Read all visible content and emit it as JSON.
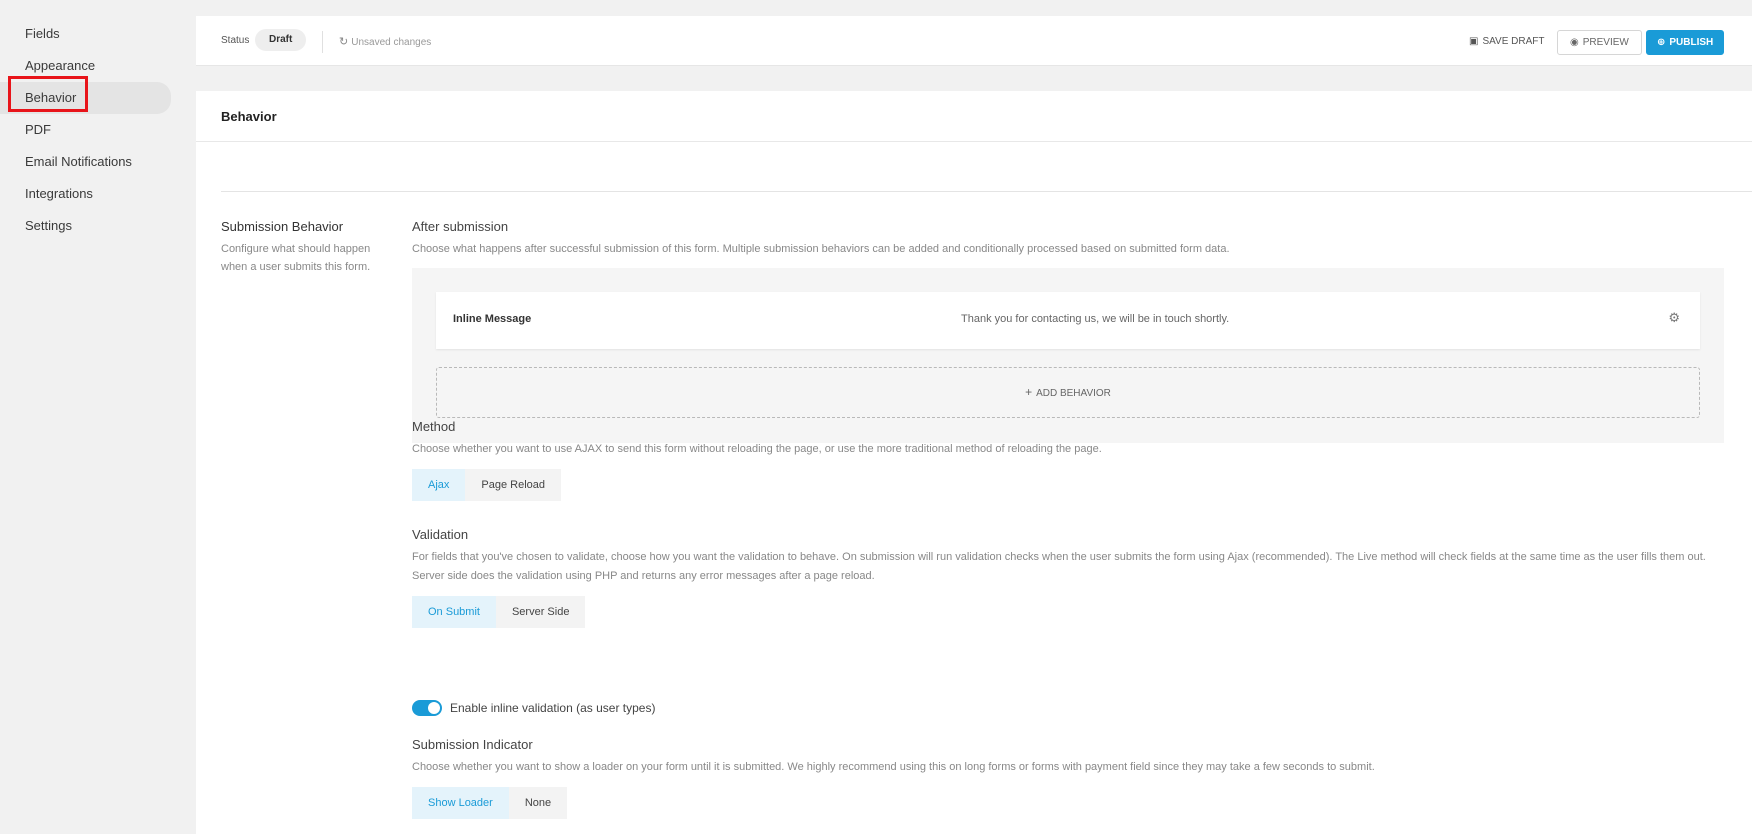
{
  "sidebar": {
    "items": [
      {
        "label": "Fields"
      },
      {
        "label": "Appearance"
      },
      {
        "label": "Behavior"
      },
      {
        "label": "PDF"
      },
      {
        "label": "Email Notifications"
      },
      {
        "label": "Integrations"
      },
      {
        "label": "Settings"
      }
    ],
    "active": "Behavior"
  },
  "topbar": {
    "status_label": "Status",
    "status_value": "Draft",
    "unsaved": "Unsaved changes",
    "save_draft": "SAVE DRAFT",
    "preview": "PREVIEW",
    "publish": "PUBLISH"
  },
  "main": {
    "title": "Behavior",
    "submission_behavior": {
      "title": "Submission Behavior",
      "description": "Configure what should happen when a user submits this form."
    },
    "after_submission": {
      "title": "After submission",
      "description": "Choose what happens after successful submission of this form. Multiple submission behaviors can be added and conditionally processed based on submitted form data.",
      "behaviors": [
        {
          "name": "Inline Message",
          "value": "Thank you for contacting us, we will be in touch shortly."
        }
      ],
      "add_label": "ADD BEHAVIOR"
    },
    "method": {
      "title": "Method",
      "description": "Choose whether you want to use AJAX to send this form without reloading the page, or use the more traditional method of reloading the page.",
      "options": [
        "Ajax",
        "Page Reload"
      ],
      "selected": "Ajax"
    },
    "validation": {
      "title": "Validation",
      "description": "For fields that you've chosen to validate, choose how you want the validation to behave. On submission will run validation checks when the user submits the form using Ajax (recommended). The Live method will check fields at the same time as the user fills them out. Server side does the validation using PHP and returns any error messages after a page reload.",
      "options": [
        "On Submit",
        "Server Side"
      ],
      "selected": "On Submit"
    },
    "inline_validation": {
      "label": "Enable inline validation (as user types)",
      "enabled": true
    },
    "submission_indicator": {
      "title": "Submission Indicator",
      "description": "Choose whether you want to show a loader on your form until it is submitted. We highly recommend using this on long forms or forms with payment field since they may take a few seconds to submit.",
      "options": [
        "Show Loader",
        "None"
      ],
      "selected": "Show Loader"
    }
  },
  "colors": {
    "accent": "#1a9bd7",
    "highlight_box": "#e8141a"
  },
  "icons": {
    "unsaved": "refresh-icon",
    "save_draft": "floppy-disk-icon",
    "preview": "eye-icon",
    "publish": "globe-icon",
    "behavior_settings": "gear-icon",
    "add": "plus-icon"
  }
}
